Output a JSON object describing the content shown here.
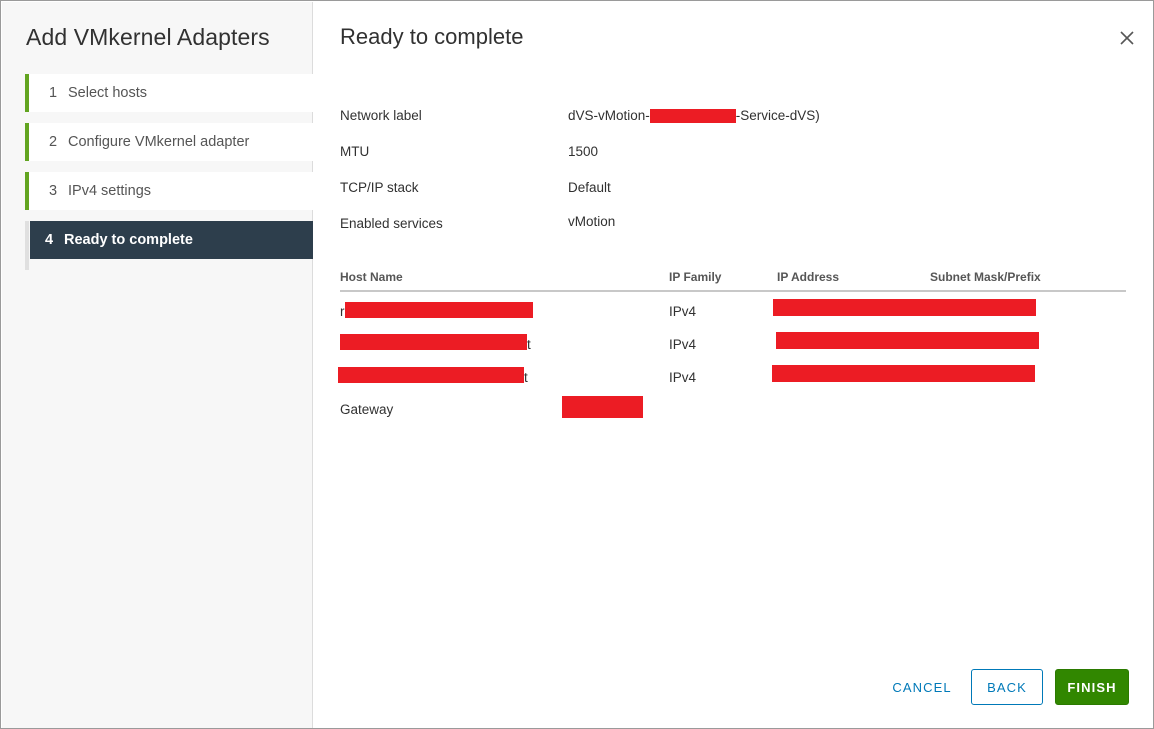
{
  "sidebar": {
    "title": "Add VMkernel Adapters",
    "steps": [
      {
        "num": "1",
        "label": "Select hosts"
      },
      {
        "num": "2",
        "label": "Configure VMkernel adapter"
      },
      {
        "num": "3",
        "label": "IPv4 settings"
      },
      {
        "num": "4",
        "label": "Ready to complete"
      }
    ]
  },
  "main": {
    "title": "Ready to complete",
    "close_icon": "close-icon",
    "properties": {
      "network_label": {
        "label": "Network label",
        "prefix": "dVS-vMotion-",
        "suffix": "-Service-dVS)"
      },
      "mtu": {
        "label": "MTU",
        "value": "1500"
      },
      "tcpip_stack": {
        "label": "TCP/IP stack",
        "value": "Default"
      },
      "enabled_services": {
        "label": "Enabled services",
        "value": "vMotion"
      }
    },
    "table": {
      "headers": [
        "Host Name",
        "IP Family",
        "IP Address",
        "Subnet Mask/Prefix"
      ],
      "rows": [
        {
          "host_prefix": "r",
          "host_suffix": "",
          "family": "IPv4"
        },
        {
          "host_prefix": "",
          "host_suffix": "t",
          "family": "IPv4"
        },
        {
          "host_prefix": "",
          "host_suffix": "t",
          "family": "IPv4"
        }
      ],
      "gateway_label": "Gateway"
    }
  },
  "footer": {
    "cancel": "CANCEL",
    "back": "BACK",
    "finish": "FINISH"
  },
  "colors": {
    "accent_green": "#62a420",
    "active_step_bg": "#2d3e4c",
    "link_blue": "#0079b8",
    "finish_green": "#318700",
    "redaction": "#ec1c24"
  }
}
